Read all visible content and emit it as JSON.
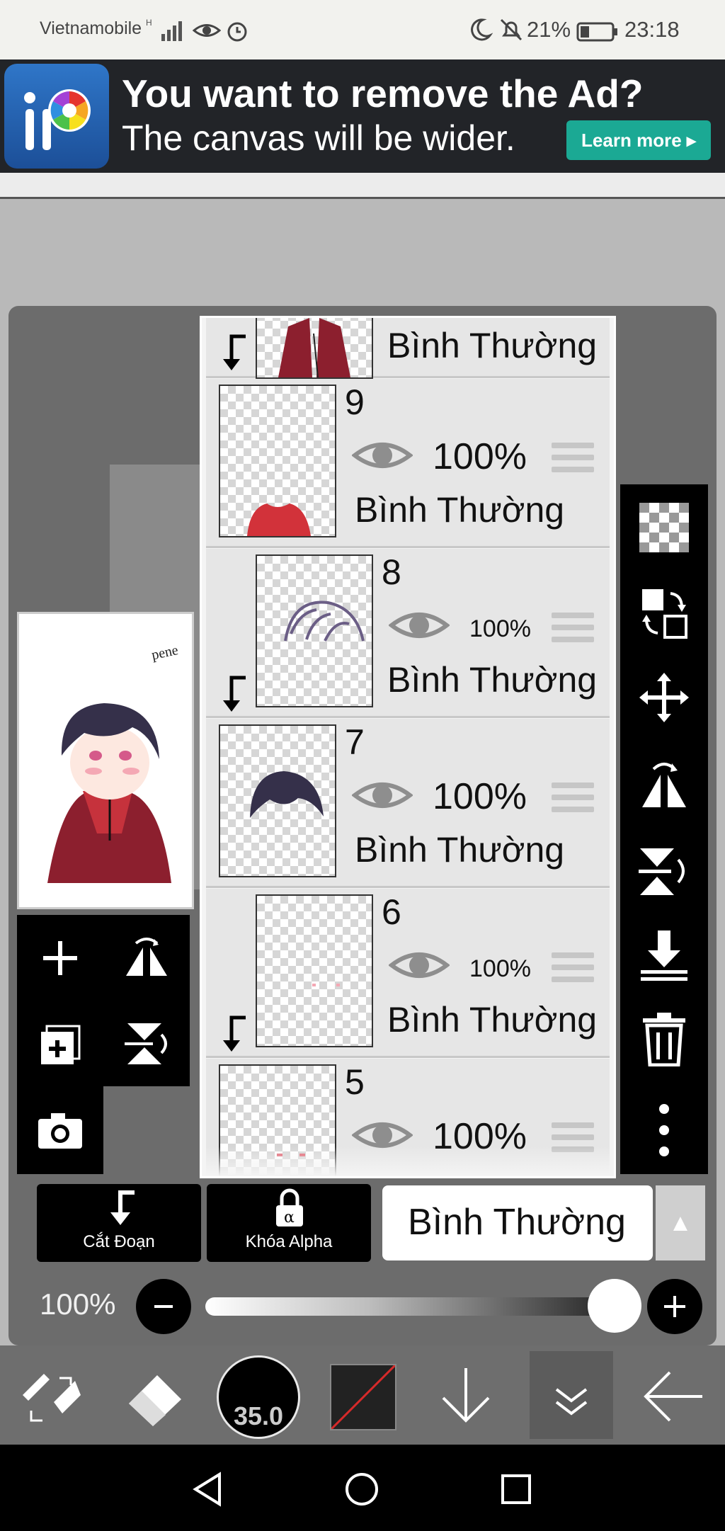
{
  "status_bar": {
    "carrier": "Vietnamobile",
    "battery": "21%",
    "time": "23:18"
  },
  "ad": {
    "headline": "You want to remove the Ad?",
    "subline": "The canvas will be wider.",
    "cta": "Learn more ▸"
  },
  "layers": [
    {
      "name": "",
      "opacity": "",
      "blend": "Bình Thường"
    },
    {
      "name": "9",
      "opacity": "100%",
      "blend": "Bình Thường"
    },
    {
      "name": "8",
      "opacity": "100%",
      "blend": "Bình Thường"
    },
    {
      "name": "7",
      "opacity": "100%",
      "blend": "Bình Thường"
    },
    {
      "name": "6",
      "opacity": "100%",
      "blend": "Bình Thường"
    },
    {
      "name": "5",
      "opacity": "100%",
      "blend": ""
    }
  ],
  "buttons": {
    "clip": "Cắt Đoạn",
    "alpha_lock": "Khóa Alpha",
    "blend_mode": "Bình Thường"
  },
  "opacity": {
    "label": "100%",
    "value": 1.0
  },
  "brush_size": "35.0",
  "colors": {
    "ad_button": "#1ba994",
    "panel": "#6c6c6c",
    "layer_bg": "#e6e6e6"
  }
}
